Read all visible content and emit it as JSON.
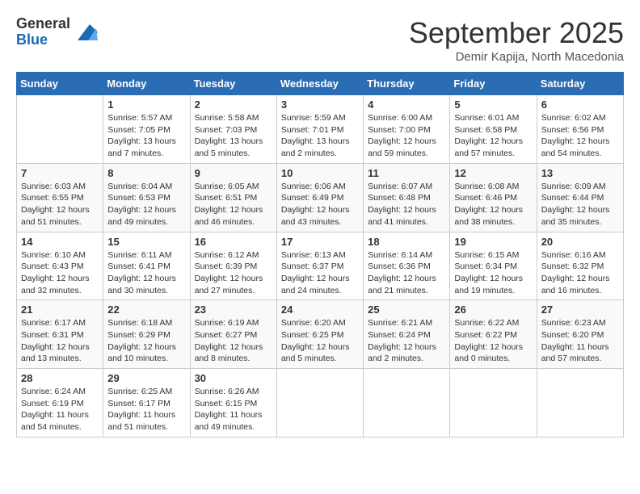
{
  "header": {
    "logo_general": "General",
    "logo_blue": "Blue",
    "month_title": "September 2025",
    "subtitle": "Demir Kapija, North Macedonia"
  },
  "days_of_week": [
    "Sunday",
    "Monday",
    "Tuesday",
    "Wednesday",
    "Thursday",
    "Friday",
    "Saturday"
  ],
  "weeks": [
    [
      {
        "day": "",
        "info": ""
      },
      {
        "day": "1",
        "info": "Sunrise: 5:57 AM\nSunset: 7:05 PM\nDaylight: 13 hours\nand 7 minutes."
      },
      {
        "day": "2",
        "info": "Sunrise: 5:58 AM\nSunset: 7:03 PM\nDaylight: 13 hours\nand 5 minutes."
      },
      {
        "day": "3",
        "info": "Sunrise: 5:59 AM\nSunset: 7:01 PM\nDaylight: 13 hours\nand 2 minutes."
      },
      {
        "day": "4",
        "info": "Sunrise: 6:00 AM\nSunset: 7:00 PM\nDaylight: 12 hours\nand 59 minutes."
      },
      {
        "day": "5",
        "info": "Sunrise: 6:01 AM\nSunset: 6:58 PM\nDaylight: 12 hours\nand 57 minutes."
      },
      {
        "day": "6",
        "info": "Sunrise: 6:02 AM\nSunset: 6:56 PM\nDaylight: 12 hours\nand 54 minutes."
      }
    ],
    [
      {
        "day": "7",
        "info": "Sunrise: 6:03 AM\nSunset: 6:55 PM\nDaylight: 12 hours\nand 51 minutes."
      },
      {
        "day": "8",
        "info": "Sunrise: 6:04 AM\nSunset: 6:53 PM\nDaylight: 12 hours\nand 49 minutes."
      },
      {
        "day": "9",
        "info": "Sunrise: 6:05 AM\nSunset: 6:51 PM\nDaylight: 12 hours\nand 46 minutes."
      },
      {
        "day": "10",
        "info": "Sunrise: 6:06 AM\nSunset: 6:49 PM\nDaylight: 12 hours\nand 43 minutes."
      },
      {
        "day": "11",
        "info": "Sunrise: 6:07 AM\nSunset: 6:48 PM\nDaylight: 12 hours\nand 41 minutes."
      },
      {
        "day": "12",
        "info": "Sunrise: 6:08 AM\nSunset: 6:46 PM\nDaylight: 12 hours\nand 38 minutes."
      },
      {
        "day": "13",
        "info": "Sunrise: 6:09 AM\nSunset: 6:44 PM\nDaylight: 12 hours\nand 35 minutes."
      }
    ],
    [
      {
        "day": "14",
        "info": "Sunrise: 6:10 AM\nSunset: 6:43 PM\nDaylight: 12 hours\nand 32 minutes."
      },
      {
        "day": "15",
        "info": "Sunrise: 6:11 AM\nSunset: 6:41 PM\nDaylight: 12 hours\nand 30 minutes."
      },
      {
        "day": "16",
        "info": "Sunrise: 6:12 AM\nSunset: 6:39 PM\nDaylight: 12 hours\nand 27 minutes."
      },
      {
        "day": "17",
        "info": "Sunrise: 6:13 AM\nSunset: 6:37 PM\nDaylight: 12 hours\nand 24 minutes."
      },
      {
        "day": "18",
        "info": "Sunrise: 6:14 AM\nSunset: 6:36 PM\nDaylight: 12 hours\nand 21 minutes."
      },
      {
        "day": "19",
        "info": "Sunrise: 6:15 AM\nSunset: 6:34 PM\nDaylight: 12 hours\nand 19 minutes."
      },
      {
        "day": "20",
        "info": "Sunrise: 6:16 AM\nSunset: 6:32 PM\nDaylight: 12 hours\nand 16 minutes."
      }
    ],
    [
      {
        "day": "21",
        "info": "Sunrise: 6:17 AM\nSunset: 6:31 PM\nDaylight: 12 hours\nand 13 minutes."
      },
      {
        "day": "22",
        "info": "Sunrise: 6:18 AM\nSunset: 6:29 PM\nDaylight: 12 hours\nand 10 minutes."
      },
      {
        "day": "23",
        "info": "Sunrise: 6:19 AM\nSunset: 6:27 PM\nDaylight: 12 hours\nand 8 minutes."
      },
      {
        "day": "24",
        "info": "Sunrise: 6:20 AM\nSunset: 6:25 PM\nDaylight: 12 hours\nand 5 minutes."
      },
      {
        "day": "25",
        "info": "Sunrise: 6:21 AM\nSunset: 6:24 PM\nDaylight: 12 hours\nand 2 minutes."
      },
      {
        "day": "26",
        "info": "Sunrise: 6:22 AM\nSunset: 6:22 PM\nDaylight: 12 hours\nand 0 minutes."
      },
      {
        "day": "27",
        "info": "Sunrise: 6:23 AM\nSunset: 6:20 PM\nDaylight: 11 hours\nand 57 minutes."
      }
    ],
    [
      {
        "day": "28",
        "info": "Sunrise: 6:24 AM\nSunset: 6:19 PM\nDaylight: 11 hours\nand 54 minutes."
      },
      {
        "day": "29",
        "info": "Sunrise: 6:25 AM\nSunset: 6:17 PM\nDaylight: 11 hours\nand 51 minutes."
      },
      {
        "day": "30",
        "info": "Sunrise: 6:26 AM\nSunset: 6:15 PM\nDaylight: 11 hours\nand 49 minutes."
      },
      {
        "day": "",
        "info": ""
      },
      {
        "day": "",
        "info": ""
      },
      {
        "day": "",
        "info": ""
      },
      {
        "day": "",
        "info": ""
      }
    ]
  ]
}
